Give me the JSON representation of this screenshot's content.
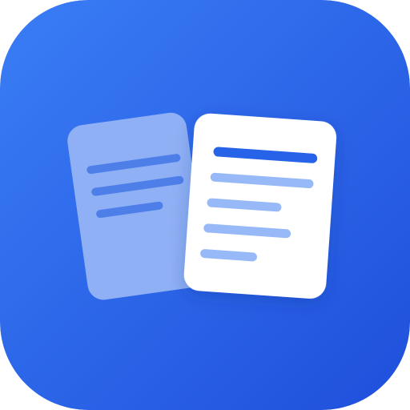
{
  "icon": {
    "name": "documents-app-icon",
    "colors": {
      "gradient_start": "#3A7DF6",
      "gradient_end": "#1F4FDB",
      "back_page": "#8FB0F4",
      "back_page_lines": "#4E7FE9",
      "front_page": "#FFFFFF",
      "front_title_line": "#2763E8",
      "front_text_lines": "#97B9F7"
    }
  }
}
